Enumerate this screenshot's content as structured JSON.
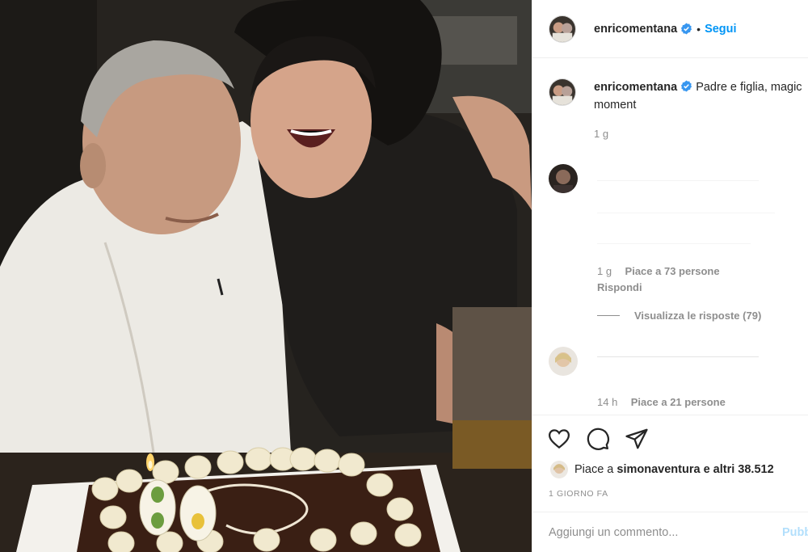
{
  "post": {
    "username": "enricomentana",
    "follow_label": "Segui",
    "separator": "•",
    "caption": "Padre e figlia, magic moment",
    "caption_time": "1 g",
    "comments": [
      {
        "time": "1 g",
        "likes": "Piace a 73 persone",
        "reply_label": "Rispondi",
        "view_replies": "Visualizza le risposte (79)"
      },
      {
        "time": "14 h",
        "likes": "Piace a 21 persone"
      }
    ],
    "liked_by_prefix": "Piace a",
    "liked_by_user": "simonaventura",
    "liked_by_suffix": "e altri 38.512",
    "date": "1 GIORNO FA",
    "add_comment_placeholder": "Aggiungi un commento...",
    "publish_label": "Pubblica"
  },
  "icons": {
    "like": "heart-icon",
    "comment": "comment-icon",
    "share": "share-icon",
    "verified": "verified-badge-icon"
  },
  "colors": {
    "accent": "#0095f6",
    "publish_disabled": "#b2dffc",
    "muted": "#8e8e8e",
    "text": "#262626"
  }
}
